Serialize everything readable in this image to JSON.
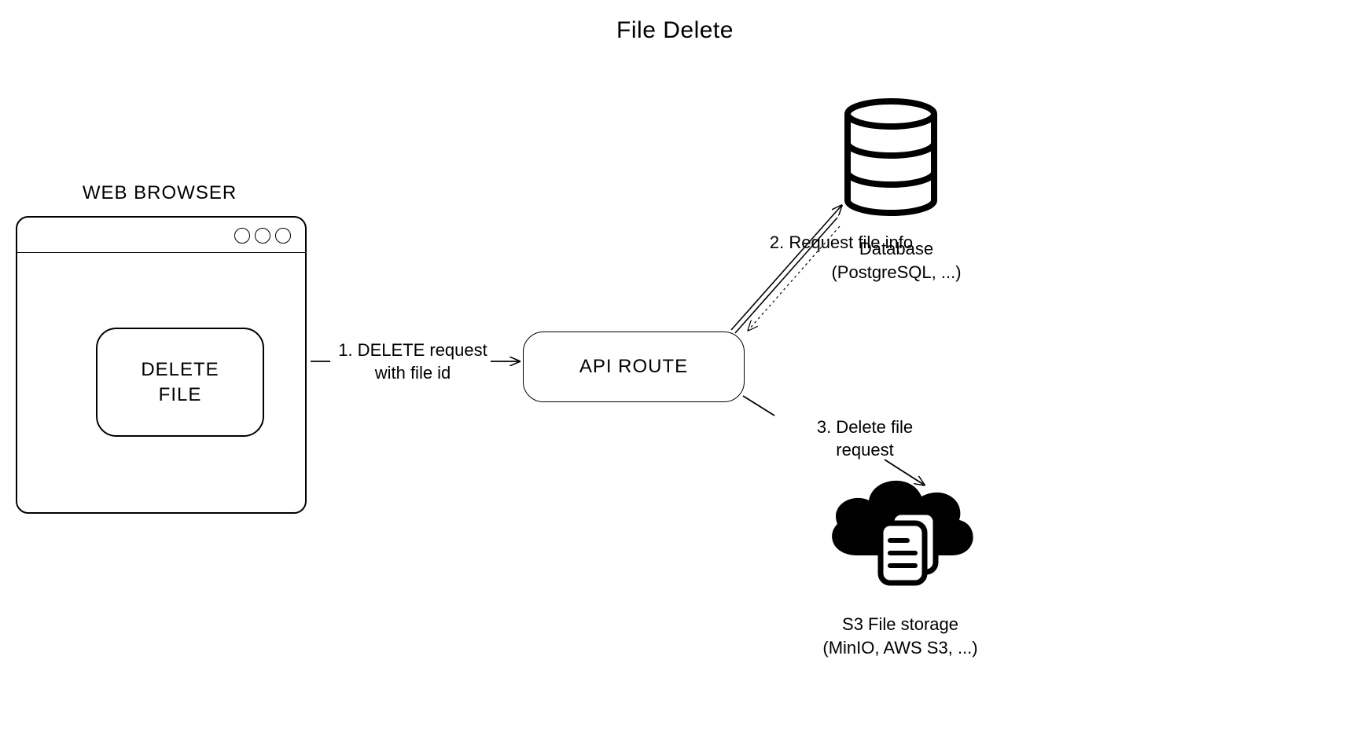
{
  "title": "File Delete",
  "browser": {
    "label": "WEB BROWSER",
    "button_text": "DELETE\nFILE"
  },
  "api": {
    "label": "API ROUTE"
  },
  "edges": [
    {
      "label": "1. DELETE request\nwith file id",
      "from": "browser",
      "to": "api",
      "style": "solid",
      "direction": "one-way"
    },
    {
      "label": "2. Request file info",
      "from": "api",
      "to": "database",
      "style": "double-with-dotted-return",
      "direction": "two-way"
    },
    {
      "label": "3. Delete file\nrequest",
      "from": "api",
      "to": "storage",
      "style": "solid",
      "direction": "one-way"
    }
  ],
  "database": {
    "label": "Database\n(PostgreSQL, ...)"
  },
  "storage": {
    "label": "S3 File storage\n(MinIO, AWS S3, ...)"
  }
}
